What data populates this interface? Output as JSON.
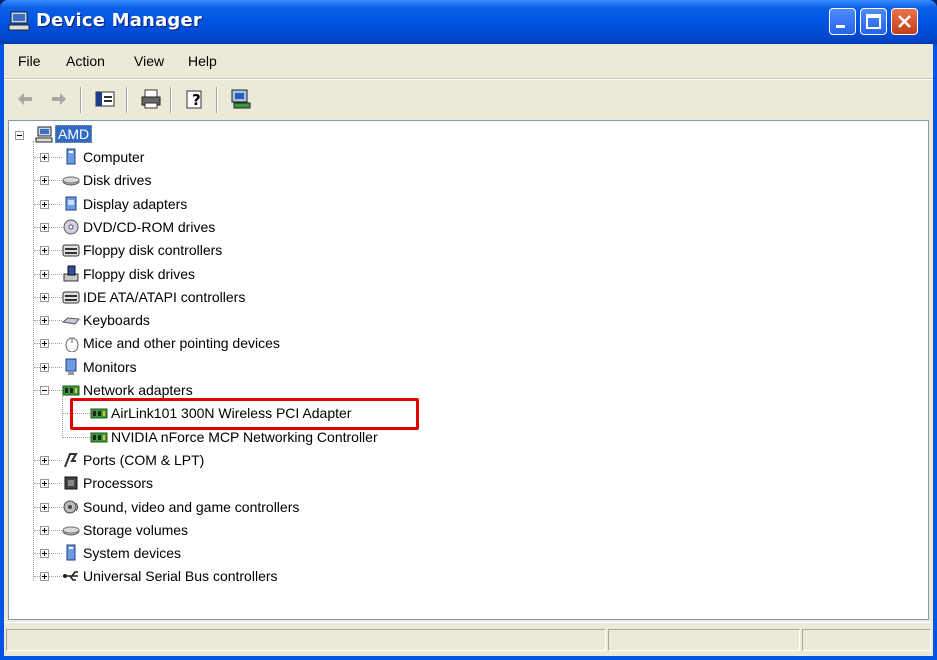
{
  "window": {
    "title": "Device Manager"
  },
  "menu": {
    "file": "File",
    "action": "Action",
    "view": "View",
    "help": "Help"
  },
  "tree": {
    "root": "AMD",
    "categories": [
      {
        "label": "Computer",
        "icon": "computer-icon",
        "expanded": false
      },
      {
        "label": "Disk drives",
        "icon": "disk-drive-icon",
        "expanded": false
      },
      {
        "label": "Display adapters",
        "icon": "display-adapter-icon",
        "expanded": false
      },
      {
        "label": "DVD/CD-ROM drives",
        "icon": "dvd-drive-icon",
        "expanded": false
      },
      {
        "label": "Floppy disk controllers",
        "icon": "controller-icon",
        "expanded": false
      },
      {
        "label": "Floppy disk drives",
        "icon": "floppy-drive-icon",
        "expanded": false
      },
      {
        "label": "IDE ATA/ATAPI controllers",
        "icon": "controller-icon",
        "expanded": false
      },
      {
        "label": "Keyboards",
        "icon": "keyboard-icon",
        "expanded": false
      },
      {
        "label": "Mice and other pointing devices",
        "icon": "mouse-icon",
        "expanded": false
      },
      {
        "label": "Monitors",
        "icon": "monitor-icon",
        "expanded": false
      },
      {
        "label": "Network adapters",
        "icon": "network-adapter-icon",
        "expanded": true,
        "children": [
          {
            "label": "AirLink101 300N Wireless PCI Adapter",
            "icon": "network-card-icon"
          },
          {
            "label": "NVIDIA nForce MCP Networking Controller",
            "icon": "network-card-icon"
          }
        ]
      },
      {
        "label": "Ports (COM & LPT)",
        "icon": "port-icon",
        "expanded": false
      },
      {
        "label": "Processors",
        "icon": "processor-icon",
        "expanded": false
      },
      {
        "label": "Sound, video and game controllers",
        "icon": "sound-icon",
        "expanded": false
      },
      {
        "label": "Storage volumes",
        "icon": "storage-icon",
        "expanded": false
      },
      {
        "label": "System devices",
        "icon": "system-device-icon",
        "expanded": false
      },
      {
        "label": "Universal Serial Bus controllers",
        "icon": "usb-icon",
        "expanded": false
      }
    ]
  },
  "colors": {
    "highlight_box": "#E00000",
    "titlebar": "#0052E0",
    "selection": "#316AC5"
  }
}
